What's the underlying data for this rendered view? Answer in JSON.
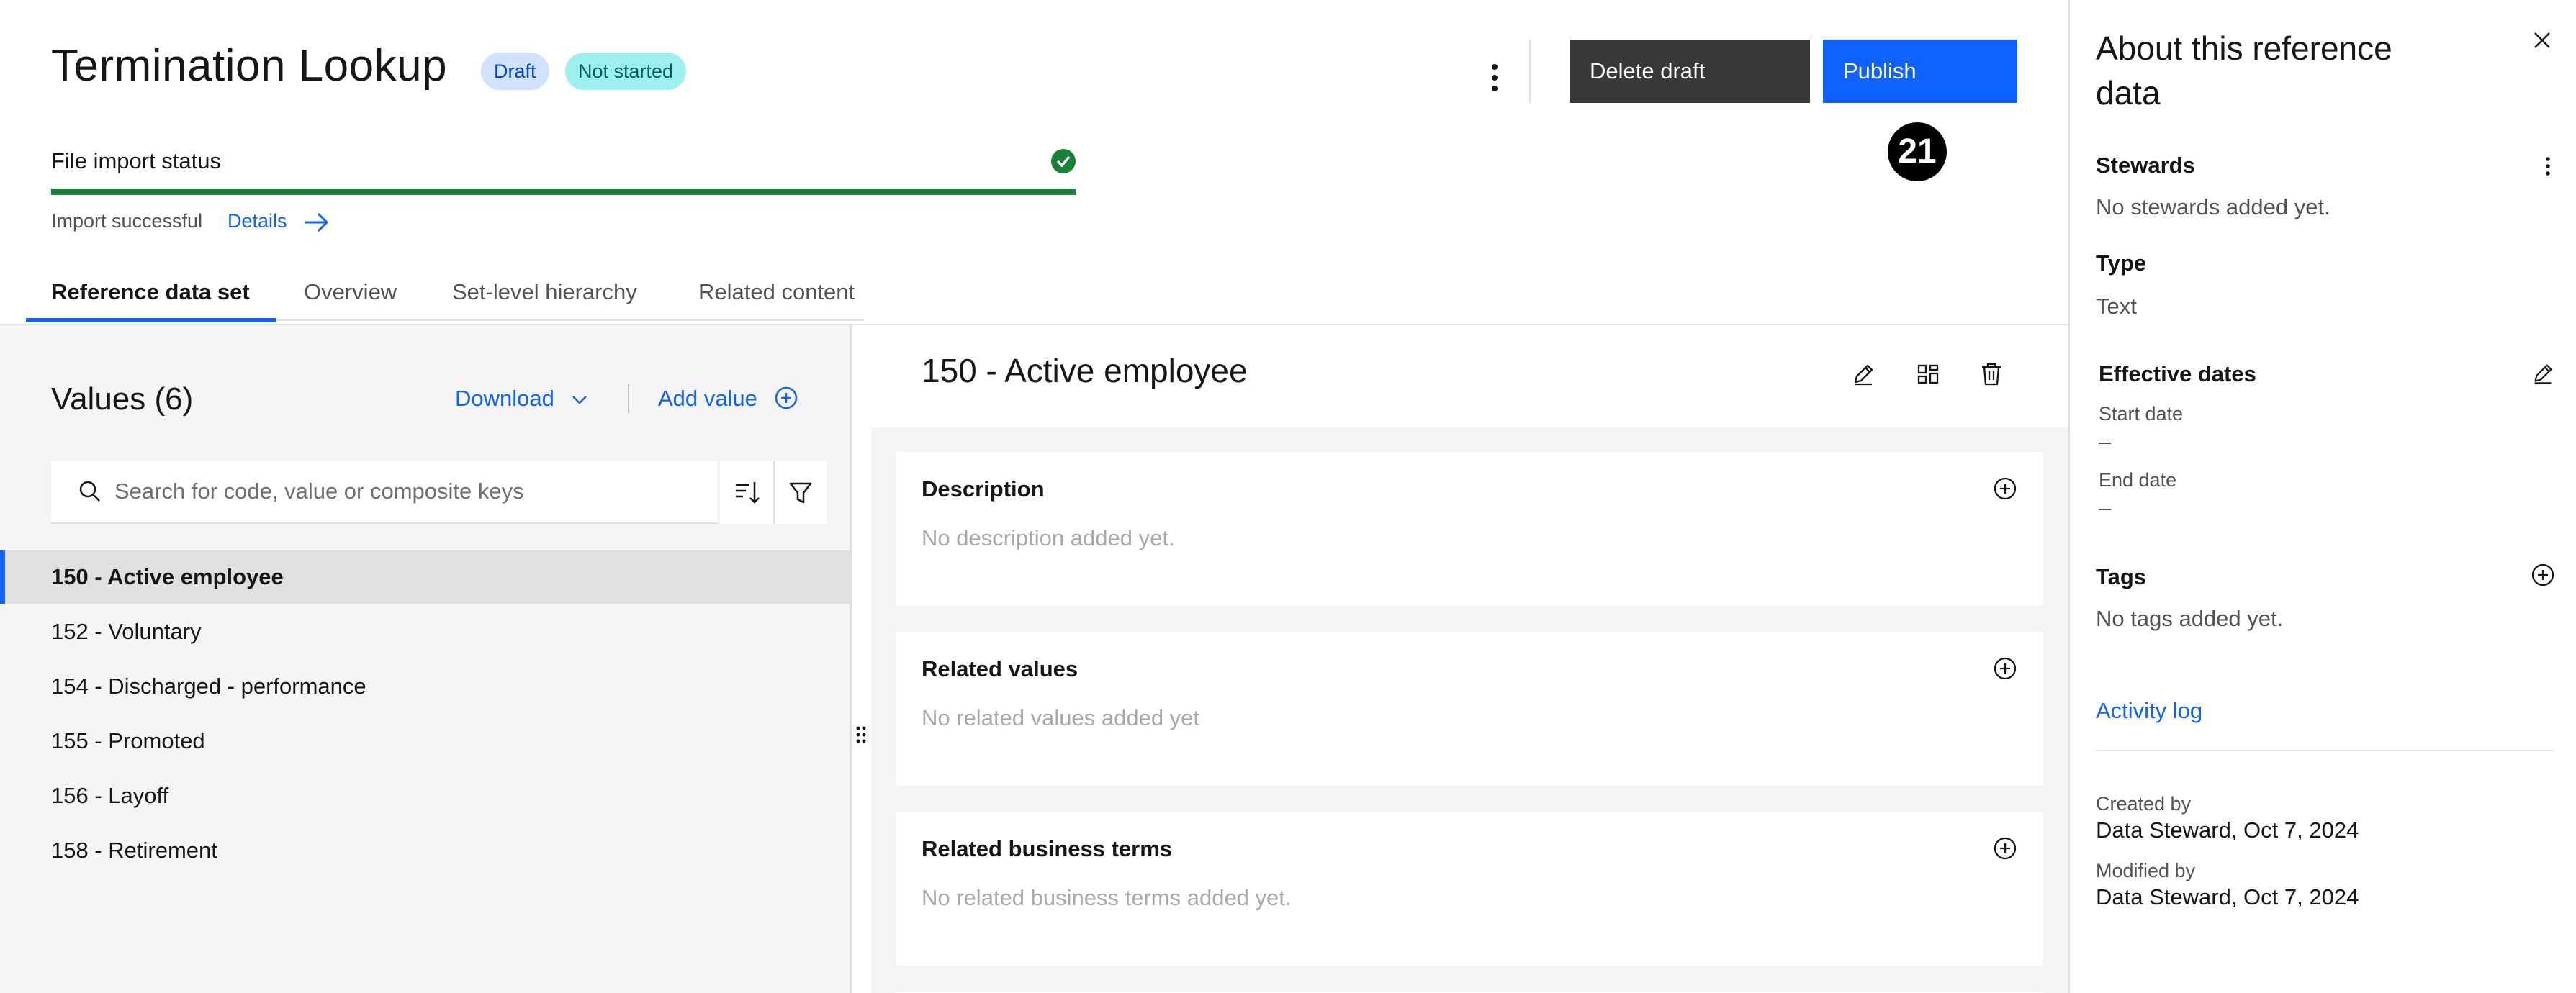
{
  "header": {
    "title": "Termination Lookup",
    "tags": [
      "Draft",
      "Not started"
    ],
    "delete_label": "Delete draft",
    "publish_label": "Publish",
    "badge": "21"
  },
  "import": {
    "label": "File import status",
    "progress_fraction": 1.0,
    "status": "Import successful",
    "details_link": "Details"
  },
  "tabs": [
    "Reference data set",
    "Overview",
    "Set-level hierarchy",
    "Related content"
  ],
  "values_panel": {
    "title": "Values (6)",
    "download_label": "Download",
    "add_value_label": "Add value",
    "search_placeholder": "Search for code, value or composite keys",
    "items": [
      "150 - Active employee",
      "152 - Voluntary",
      "154 - Discharged - performance",
      "155 - Promoted",
      "156 - Layoff",
      "158 - Retirement"
    ]
  },
  "detail": {
    "title": "150 - Active employee",
    "cards": [
      {
        "title": "Description",
        "empty": "No description added yet."
      },
      {
        "title": "Related values",
        "empty": "No related values added yet"
      },
      {
        "title": "Related business terms",
        "empty": "No related business terms added yet."
      }
    ]
  },
  "about": {
    "title": "About this reference data",
    "stewards_label": "Stewards",
    "stewards_empty": "No stewards added yet.",
    "type_label": "Type",
    "type_value": "Text",
    "effective_dates_label": "Effective dates",
    "start_date_label": "Start date",
    "start_date_value": "–",
    "end_date_label": "End date",
    "end_date_value": "–",
    "tags_label": "Tags",
    "tags_empty": "No tags added yet.",
    "activity_log": "Activity log",
    "created_by_label": "Created by",
    "created_by_value": "Data Steward, Oct 7, 2024",
    "modified_by_label": "Modified by",
    "modified_by_value": "Data Steward, Oct 7, 2024"
  },
  "colors": {
    "primary": "#0f62fe",
    "success": "#198038",
    "draft_tag_bg": "#d0e2ff",
    "not_started_tag_bg": "#9ef0f0",
    "delete_button_bg": "#393939"
  },
  "icons": [
    "overflow-menu-icon",
    "checkmark-filled-icon",
    "arrow-right-icon",
    "chevron-down-icon",
    "add-circle-icon",
    "search-icon",
    "sort-icon",
    "filter-icon",
    "drag-handle-icon",
    "edit-icon",
    "layout-icon",
    "trash-icon",
    "close-icon"
  ]
}
